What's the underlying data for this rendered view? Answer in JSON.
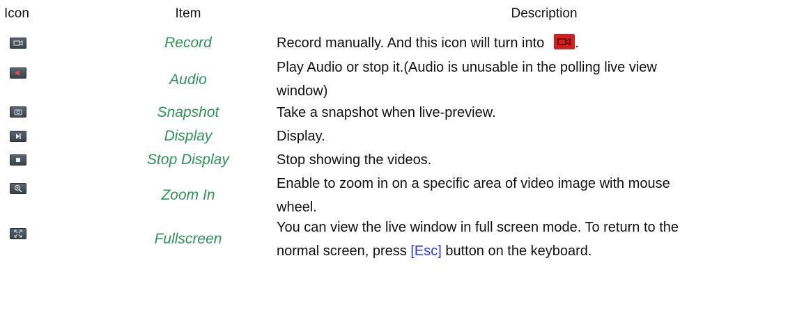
{
  "header": {
    "icon": "Icon",
    "item": "Item",
    "description": "Description"
  },
  "rows": [
    {
      "icon": "record-icon",
      "item": "Record",
      "desc": [
        "Record manually. And this icon will turn into",
        "."
      ]
    },
    {
      "icon": "audio-icon",
      "item": "Audio",
      "desc": [
        "Play Audio or stop it.(Audio is unusable in the polling live view",
        "window)"
      ]
    },
    {
      "icon": "snapshot-icon",
      "item": "Snapshot",
      "desc": [
        "Take a snapshot when live-preview."
      ]
    },
    {
      "icon": "display-icon",
      "item": "Display",
      "desc": [
        "Display."
      ]
    },
    {
      "icon": "stop-display-icon",
      "item": "Stop Display",
      "desc": [
        "Stop showing the videos."
      ]
    },
    {
      "icon": "zoom-in-icon",
      "item": "Zoom In",
      "desc": [
        "Enable to zoom in on a specific area of video image with mouse",
        "wheel."
      ]
    },
    {
      "icon": "fullscreen-icon",
      "item": "Fullscreen",
      "desc": [
        "You can view the live window in full screen mode. To return to the",
        "normal screen, press",
        "[Esc]",
        "button on the keyboard."
      ]
    }
  ],
  "colors": {
    "item_text": "#2e9357",
    "esc_link": "#2a39e8",
    "record_active": "#d71e1e"
  }
}
